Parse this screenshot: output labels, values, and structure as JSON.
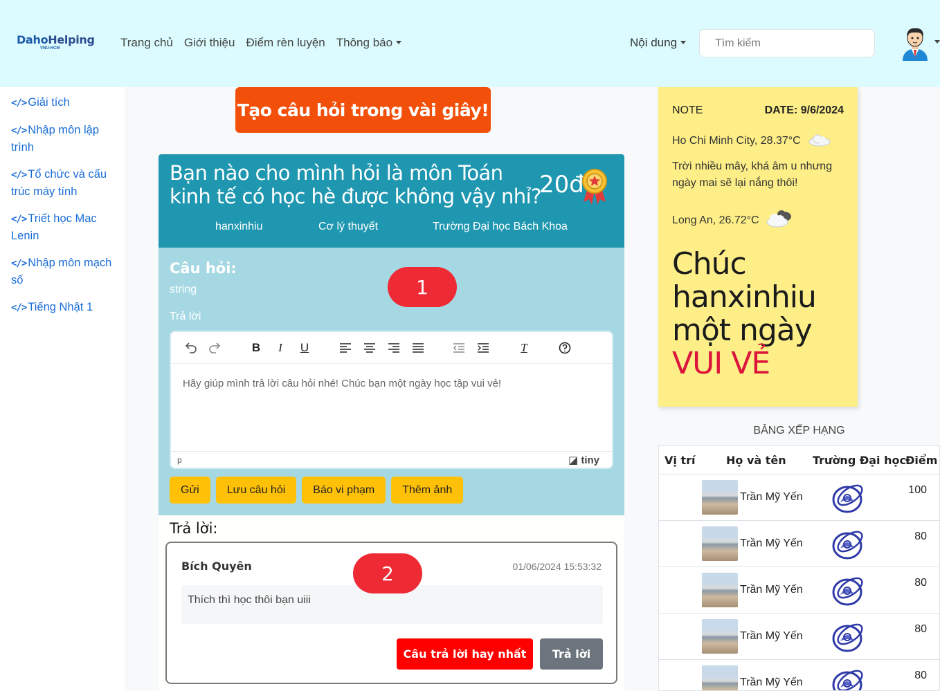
{
  "brand": {
    "main": "Daho",
    "accent": "Helping",
    "sub": "VNU-HCM"
  },
  "nav": {
    "links": [
      "Trang chủ",
      "Giới thiệu",
      "Điểm rèn luyện",
      "Thông báo"
    ],
    "content": "Nội dung",
    "search_placeholder": "Tìm kiếm"
  },
  "sidebar": {
    "icon": "</>",
    "items": [
      {
        "label": "Giải tích"
      },
      {
        "label": "Nhập môn lập trình"
      },
      {
        "label": "Tổ chức và cấu trúc máy tính"
      },
      {
        "label": "Triết học Mac Lenin"
      },
      {
        "label": "Nhập môn mạch số"
      },
      {
        "label": "Tiếng Nhật 1"
      }
    ]
  },
  "create_button": "Tạo câu hỏi trong vài giây!",
  "question": {
    "title": "Bạn nào cho mình hỏi là môn Toán kinh tế có học hè được không vậy nhỉ?",
    "points": "20đ",
    "author": "hanxinhiu",
    "subject": "Cơ lý thuyết",
    "school": "Trường Đại học Bách Khoa",
    "label": "Câu hỏi:",
    "body": "string",
    "answer_label": "Trả lời",
    "editor_text": "Hãy giúp mình trả lời câu hỏi nhé! Chúc bạn một ngày học tập vui vẻ!",
    "editor_status": "p",
    "editor_brand": "tiny",
    "buttons": {
      "send": "Gửi",
      "save": "Lưu câu hỏi",
      "report": "Báo vi phạm",
      "add_image": "Thêm ảnh"
    },
    "badge": "1"
  },
  "answers": {
    "label": "Trả lời:",
    "badge": "2",
    "items": [
      {
        "author": "Bích Quyên",
        "time": "01/06/2024 15:53:32",
        "body": "Thích thì học thôi bạn uiii",
        "best_label": "Câu trả lời hay nhất",
        "reply_label": "Trả lời"
      }
    ]
  },
  "note": {
    "label": "NOTE",
    "date": "DATE: 9/6/2024",
    "weather1": "Ho Chi Minh City, 28.37°C",
    "message": "Trời nhiều mây, khá âm u nhưng ngày mai sẽ lại nắng thôi!",
    "weather2": "Long An, 26.72°C",
    "cheer_line1": "Chúc",
    "cheer_line2": "hanxinhiu",
    "cheer_line3": "một ngày",
    "cheer_line4": "VUI VẺ"
  },
  "ranking": {
    "title": "BẢNG XẾP HẠNG",
    "headers": {
      "position": "Vị trí",
      "name": "Họ và tên",
      "school": "Trường Đại học",
      "score": "Điểm"
    },
    "rows": [
      {
        "position": "",
        "name": "Trần Mỹ Yến",
        "score": "100"
      },
      {
        "position": "",
        "name": "Trần Mỹ Yến",
        "score": "80"
      },
      {
        "position": "",
        "name": "Trần Mỹ Yến",
        "score": "80"
      },
      {
        "position": "",
        "name": "Trần Mỹ Yến",
        "score": "80"
      },
      {
        "position": "",
        "name": "Trần Mỹ Yến",
        "score": "80"
      }
    ]
  },
  "colors": {
    "navbar": "#dcfbfe",
    "create_button": "#f2500a",
    "question_header": "#1f97b0",
    "question_body": "#a6d8e4",
    "action_button": "#ffc107",
    "badge": "#ee2a35",
    "note": "#fdee87",
    "best_answer": "#ff0000"
  }
}
